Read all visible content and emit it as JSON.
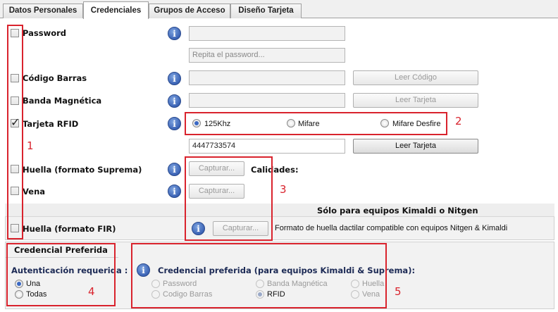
{
  "tabs": [
    {
      "label": "Datos Personales"
    },
    {
      "label": "Credenciales"
    },
    {
      "label": "Grupos de Acceso"
    },
    {
      "label": "Diseño Tarjeta"
    }
  ],
  "rows": {
    "password": {
      "label": "Password",
      "checked": false,
      "repeat_placeholder": "Repita el password..."
    },
    "barcode": {
      "label": "Código Barras",
      "checked": false,
      "button": "Leer Código"
    },
    "magstripe": {
      "label": "Banda Magnética",
      "checked": false,
      "button": "Leer Tarjeta"
    },
    "rfid": {
      "label": "Tarjeta RFID",
      "checked": true,
      "options": [
        "125Khz",
        "Mifare",
        "Mifare Desfire"
      ],
      "selected": "125Khz",
      "value": "4447733574",
      "button": "Leer Tarjeta"
    },
    "huella_suprema": {
      "label": "Huella (formato Suprema)",
      "checked": false,
      "button": "Capturar...",
      "qualities": "Calidades:"
    },
    "vena": {
      "label": "Vena",
      "checked": false,
      "button": "Capturar..."
    },
    "kimaldi_header": "Sólo para equipos Kimaldi o Nitgen",
    "huella_fir": {
      "label": "Huella (formato FIR)",
      "checked": false,
      "button": "Capturar...",
      "description": "Formato de huella dactilar compatible con equipos Nitgen & Kimaldi"
    }
  },
  "preferred": {
    "title": "Credencial Preferida",
    "auth_label": "Autenticación requerida :",
    "auth_options": [
      "Una",
      "Todas"
    ],
    "auth_selected": "Una",
    "cred_label": "Credencial preferida (para equipos Kimaldi & Suprema):",
    "cred_options": [
      "Password",
      "Banda Magnética",
      "Huella",
      "Codigo Barras",
      "RFID",
      "Vena"
    ],
    "cred_selected": "RFID"
  },
  "annotations": [
    "1",
    "2",
    "3",
    "4",
    "5"
  ],
  "colors": {
    "annotation": "#d9232d",
    "info_icon": "#3b63b5",
    "radio_selected": "#3a68c4"
  }
}
